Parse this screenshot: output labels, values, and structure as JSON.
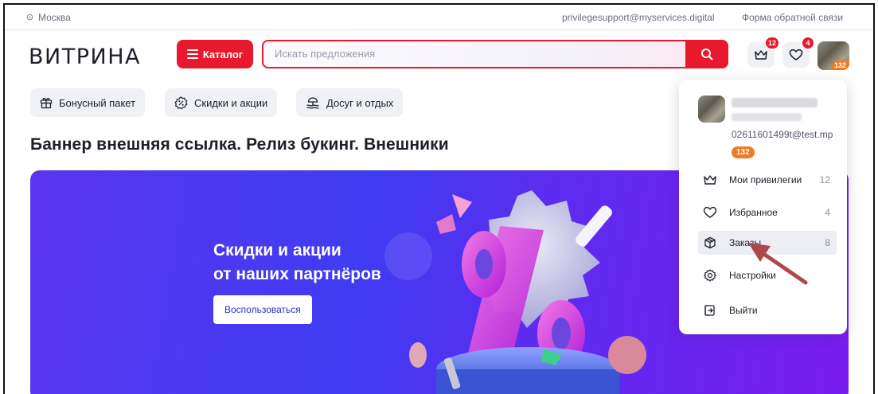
{
  "topbar": {
    "city": "Москва",
    "email": "privilegesupport@myservices.digital",
    "feedback": "Форма обратной связи"
  },
  "header": {
    "logo": "ВИТРИНА",
    "catalog_label": "Каталог",
    "search_placeholder": "Искать предложения",
    "privileges_badge": "12",
    "favorites_badge": "4",
    "avatar_points": "132"
  },
  "chips": [
    {
      "label": "Бонусный пакет",
      "icon": "gift-icon"
    },
    {
      "label": "Скидки и акции",
      "icon": "discount-icon"
    },
    {
      "label": "Досуг и отдых",
      "icon": "leisure-icon"
    }
  ],
  "headline": "Баннер внешняя ссылка. Релиз букинг. Внешники",
  "banner": {
    "title_line1": "Скидки и акции",
    "title_line2": "от наших партнёров",
    "button_label": "Воспользоваться"
  },
  "dropdown": {
    "email": "02611601499t@test.mp",
    "points": "132",
    "items": [
      {
        "label": "Мои привилегии",
        "count": "12",
        "icon": "crown-icon"
      },
      {
        "label": "Избранное",
        "count": "4",
        "icon": "heart-icon"
      },
      {
        "label": "Заказы",
        "count": "8",
        "icon": "box-icon"
      },
      {
        "label": "Настройки",
        "count": "",
        "icon": "gear-icon"
      },
      {
        "label": "Выйти",
        "count": "",
        "icon": "logout-icon"
      }
    ]
  },
  "colors": {
    "accent": "#e8192c",
    "points": "#f07a24",
    "banner": "#4b3af0",
    "annotation_arrow": "#b0474a"
  }
}
